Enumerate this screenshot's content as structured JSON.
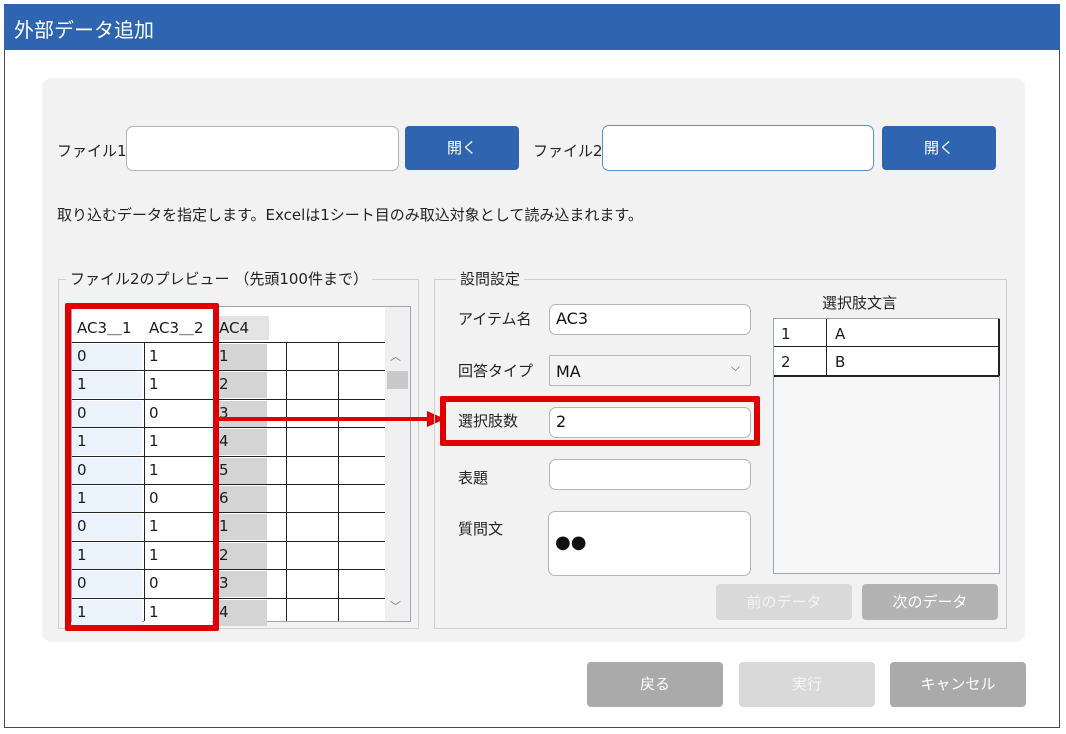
{
  "window": {
    "title": "外部データ追加"
  },
  "files": {
    "file1_label": "ファイル1",
    "file1_value": "",
    "file2_label": "ファイル2",
    "file2_value": "",
    "open1_label": "開く",
    "open2_label": "開く"
  },
  "instruction": "取り込むデータを指定します。Excelは1シート目のみ取込対象として読み込まれます。",
  "preview": {
    "legend": "ファイル2のプレビュー （先頭100件まで）",
    "columns": [
      "AC3＿1",
      "AC3＿2",
      "AC4"
    ],
    "rows": [
      [
        "0",
        "1",
        "1"
      ],
      [
        "1",
        "1",
        "2"
      ],
      [
        "0",
        "0",
        "3"
      ],
      [
        "1",
        "1",
        "4"
      ],
      [
        "0",
        "1",
        "5"
      ],
      [
        "1",
        "0",
        "6"
      ],
      [
        "0",
        "1",
        "1"
      ],
      [
        "1",
        "1",
        "2"
      ],
      [
        "0",
        "0",
        "3"
      ],
      [
        "1",
        "1",
        "4"
      ]
    ]
  },
  "question": {
    "legend": "設問設定",
    "item_name_label": "アイテム名",
    "item_name_value": "AC3",
    "answer_type_label": "回答タイプ",
    "answer_type_value": "MA",
    "choice_count_label": "選択肢数",
    "choice_count_value": "2",
    "title_label": "表題",
    "title_value": "",
    "question_text_label": "質問文",
    "question_text_value": "●●"
  },
  "choices": {
    "header": "選択肢文言",
    "rows": [
      {
        "num": "1",
        "text": "A"
      },
      {
        "num": "2",
        "text": "B"
      }
    ]
  },
  "nav": {
    "prev_label": "前のデータ",
    "next_label": "次のデータ"
  },
  "footer": {
    "back_label": "戻る",
    "execute_label": "実行",
    "cancel_label": "キャンセル"
  },
  "colors": {
    "title_bar": "#2f64b0",
    "primary_button": "#2f64b0",
    "highlight": "#e00000"
  }
}
